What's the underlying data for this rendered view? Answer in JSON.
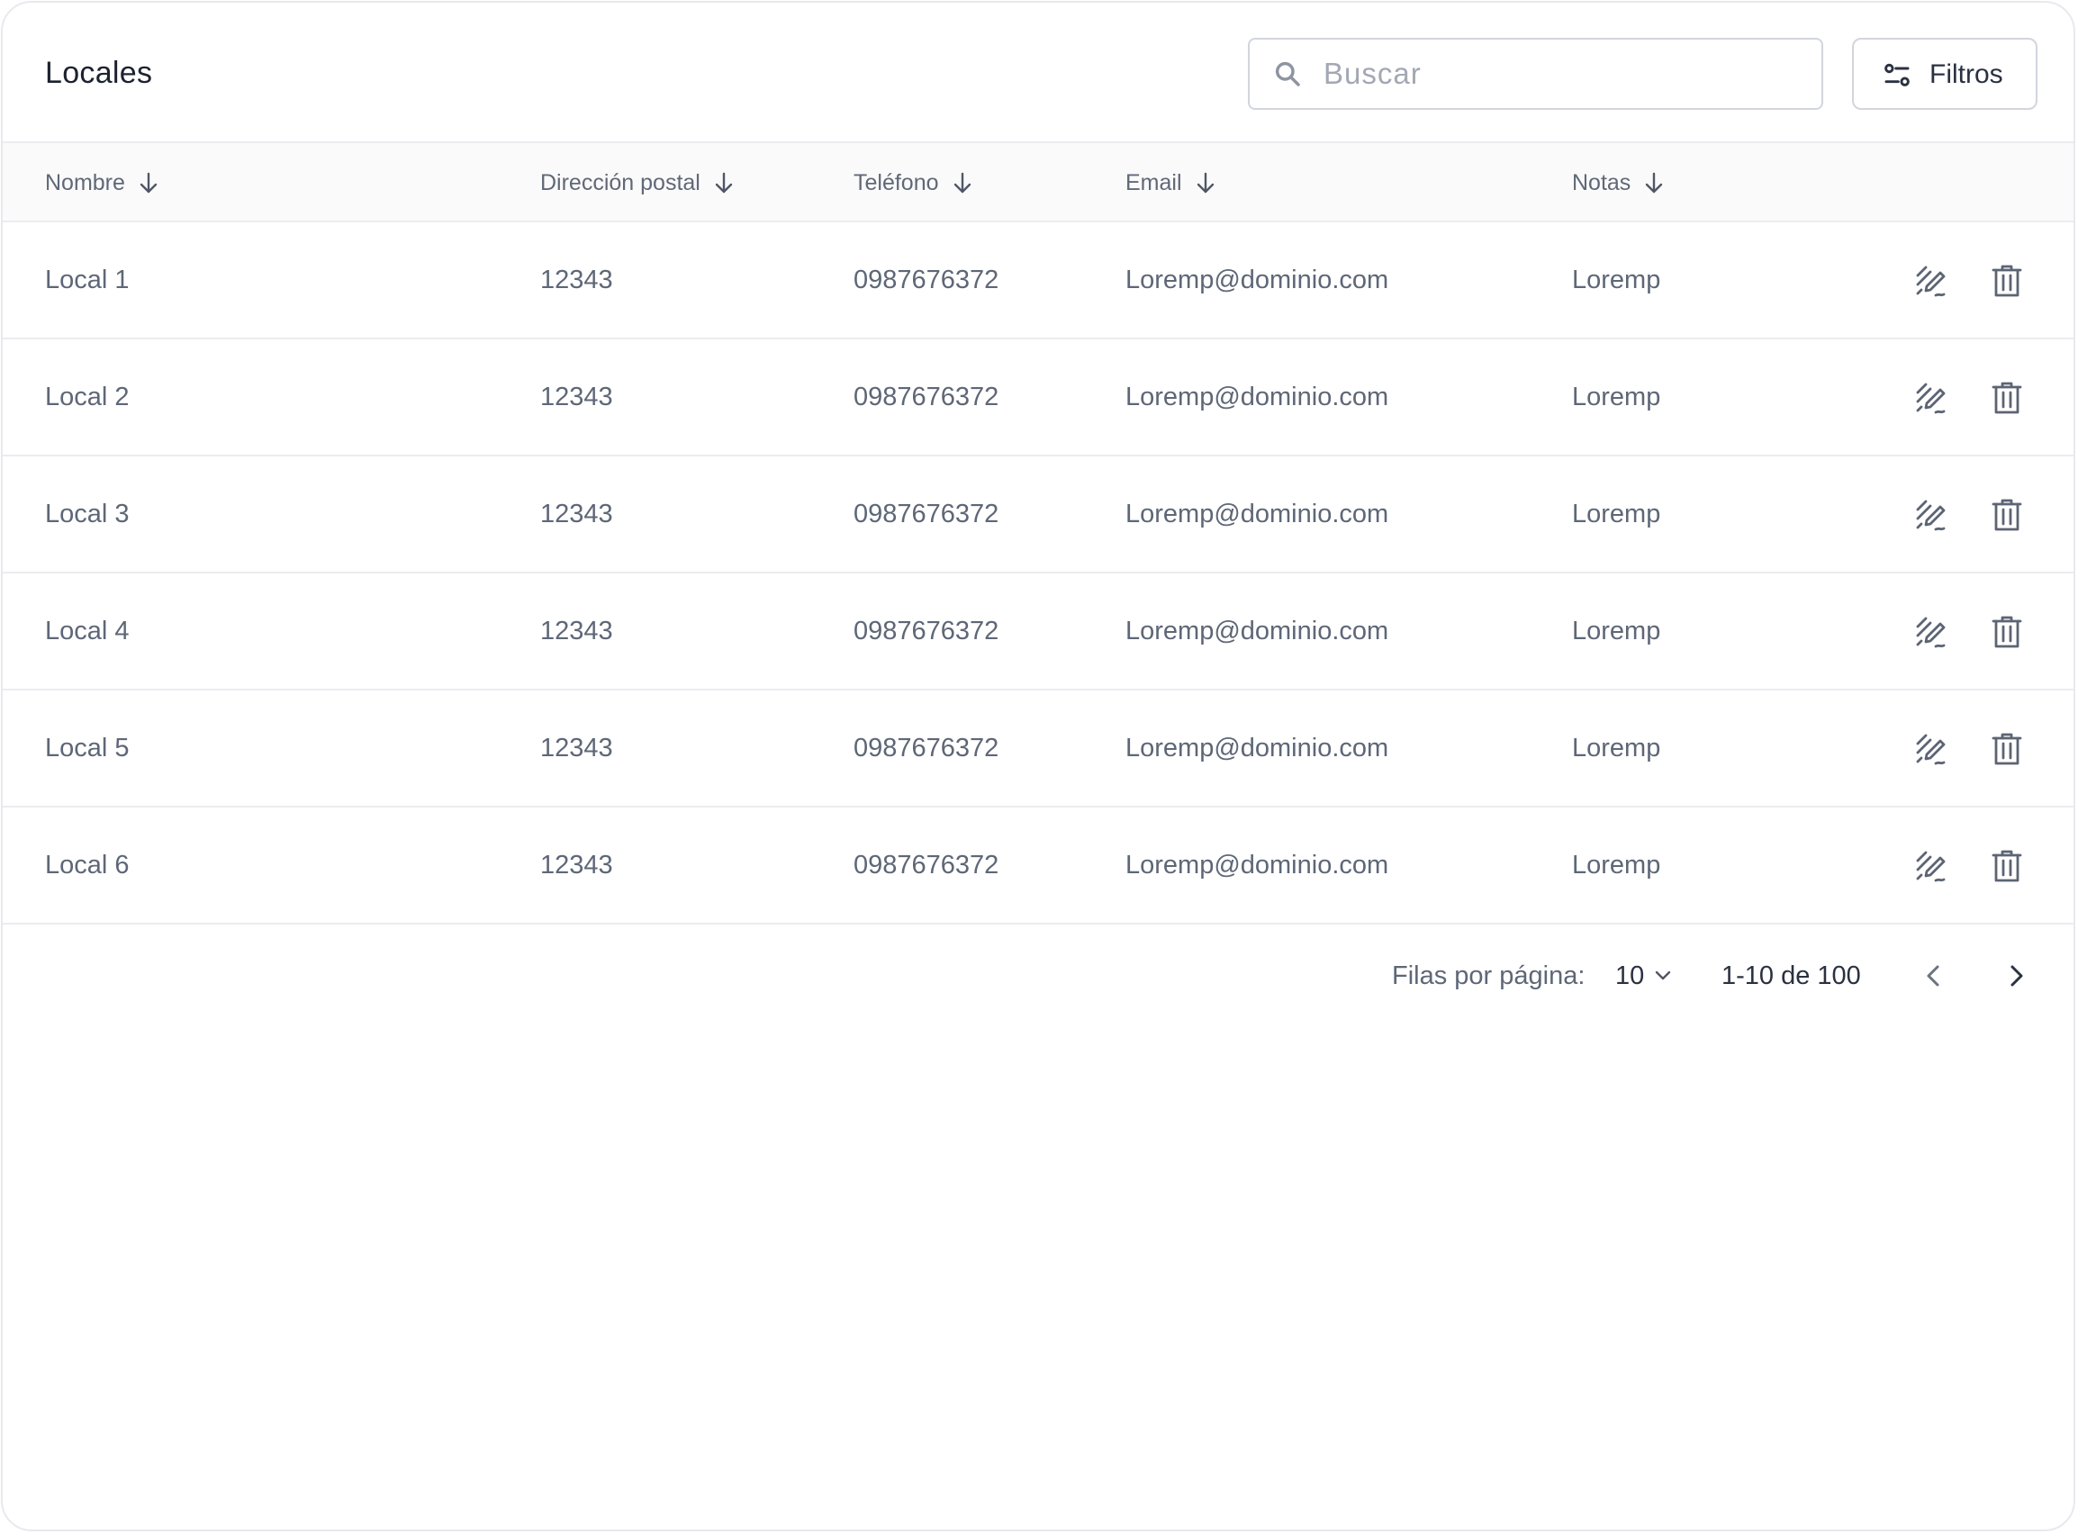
{
  "header": {
    "title": "Locales",
    "search_placeholder": "Buscar",
    "search_value": "",
    "filters_label": "Filtros"
  },
  "table": {
    "columns": [
      {
        "label": "Nombre"
      },
      {
        "label": "Dirección postal"
      },
      {
        "label": "Teléfono"
      },
      {
        "label": "Email"
      },
      {
        "label": "Notas"
      }
    ],
    "rows": [
      {
        "nombre": "Local 1",
        "direccion": "12343",
        "telefono": "0987676372",
        "email": "Loremp@dominio.com",
        "notas": "Loremp"
      },
      {
        "nombre": "Local 2",
        "direccion": "12343",
        "telefono": "0987676372",
        "email": "Loremp@dominio.com",
        "notas": "Loremp"
      },
      {
        "nombre": "Local 3",
        "direccion": "12343",
        "telefono": "0987676372",
        "email": "Loremp@dominio.com",
        "notas": "Loremp"
      },
      {
        "nombre": "Local 4",
        "direccion": "12343",
        "telefono": "0987676372",
        "email": "Loremp@dominio.com",
        "notas": "Loremp"
      },
      {
        "nombre": "Local 5",
        "direccion": "12343",
        "telefono": "0987676372",
        "email": "Loremp@dominio.com",
        "notas": "Loremp"
      },
      {
        "nombre": "Local 6",
        "direccion": "12343",
        "telefono": "0987676372",
        "email": "Loremp@dominio.com",
        "notas": "Loremp"
      }
    ],
    "row_actions": [
      "edit-icon",
      "trash-icon"
    ]
  },
  "pagination": {
    "rows_per_page_label": "Filas por página:",
    "rows_per_page_value": "10",
    "range_text": "1-10 de 100"
  },
  "icons": {
    "search": "search-icon",
    "filters": "sliders-icon",
    "sort": "arrow-down-icon",
    "select": "chevron-down-icon",
    "prev": "chevron-left-icon",
    "next": "chevron-right-icon"
  },
  "colors": {
    "text_primary": "#1c2230",
    "text_secondary": "#5e6777",
    "border": "#d2d5dd",
    "header_bg": "#fafafa"
  }
}
